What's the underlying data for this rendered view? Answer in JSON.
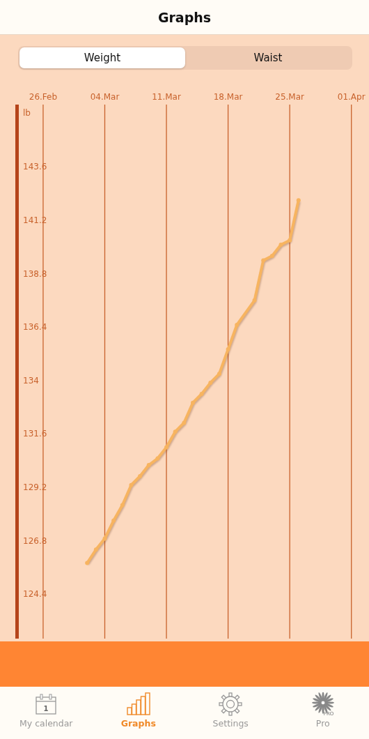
{
  "title": "Graphs",
  "segments": [
    {
      "label": "Weight",
      "selected": true
    },
    {
      "label": "Waist",
      "selected": false
    }
  ],
  "chart": {
    "unit": "lb",
    "chart_data": {
      "type": "line",
      "grid": true,
      "ylim": [
        122.4,
        146.4
      ],
      "categories": [
        "26.Feb",
        null,
        null,
        null,
        null,
        null,
        null,
        "04.Mar",
        null,
        null,
        null,
        null,
        null,
        null,
        "11.Mar",
        null,
        null,
        null,
        null,
        null,
        null,
        "18.Mar",
        null,
        null,
        null,
        null,
        null,
        null,
        "25.Mar",
        null,
        null,
        null,
        null,
        null,
        null,
        "01.Apr"
      ],
      "yticks": [
        {
          "value": 124.4,
          "label": "124.4"
        },
        {
          "value": 126.8,
          "label": "126.8"
        },
        {
          "value": 129.2,
          "label": "129.2"
        },
        {
          "value": 131.6,
          "label": "131.6"
        },
        {
          "value": 134,
          "label": "134"
        },
        {
          "value": 136.4,
          "label": "136.4"
        },
        {
          "value": 138.8,
          "label": "138.8"
        },
        {
          "value": 141.2,
          "label": "141.2"
        },
        {
          "value": 143.6,
          "label": "143.6"
        }
      ],
      "series": [
        {
          "color": "#f7b460",
          "marker": true,
          "values": [
            null,
            null,
            null,
            null,
            null,
            125.8,
            126.4,
            126.9,
            127.7,
            128.4,
            129.3,
            129.7,
            130.2,
            130.5,
            131.0,
            131.7,
            132.1,
            133.0,
            133.4,
            133.9,
            134.3,
            135.4,
            136.5,
            null,
            137.6,
            139.4,
            139.6,
            140.1,
            140.3,
            142.1,
            null,
            null,
            null,
            null,
            null,
            null
          ]
        }
      ]
    }
  },
  "tabs": [
    {
      "kind": "calendar",
      "label": "My calendar",
      "badge": "1",
      "selected": false
    },
    {
      "kind": "graphs",
      "label": "Graphs",
      "selected": true
    },
    {
      "kind": "settings",
      "label": "Settings",
      "selected": false
    },
    {
      "kind": "pro",
      "label": "Pro",
      "badge": "PRO",
      "selected": false
    }
  ]
}
